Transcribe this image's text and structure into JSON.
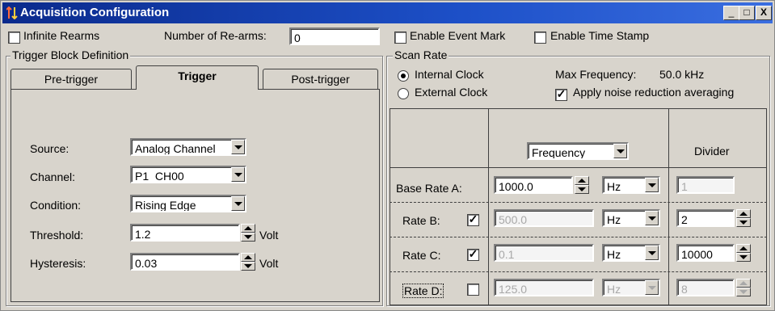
{
  "window": {
    "title": "Acquisition Configuration",
    "controls": [
      "_",
      "□",
      "X"
    ]
  },
  "top": {
    "infinite_rearms": {
      "label": "Infinite Rearms",
      "checked": false
    },
    "num_rearms": {
      "label": "Number of Re-arms:",
      "value": "0"
    },
    "enable_event_mark": {
      "label": "Enable Event Mark",
      "checked": false
    },
    "enable_time_stamp": {
      "label": "Enable Time Stamp",
      "checked": false
    }
  },
  "trigger_block": {
    "title": "Trigger Block Definition",
    "tabs": [
      {
        "label": "Pre-trigger",
        "active": false
      },
      {
        "label": "Trigger",
        "active": true
      },
      {
        "label": "Post-trigger",
        "active": false
      }
    ],
    "source": {
      "label": "Source:",
      "value": "Analog Channel"
    },
    "channel": {
      "label": "Channel:",
      "value": "P1_CH00"
    },
    "condition": {
      "label": "Condition:",
      "value": "Rising Edge"
    },
    "threshold": {
      "label": "Threshold:",
      "value": "1.2",
      "unit": "Volt"
    },
    "hysteresis": {
      "label": "Hysteresis:",
      "value": "0.03",
      "unit": "Volt"
    }
  },
  "scan_rate": {
    "title": "Scan Rate",
    "internal_clock": {
      "label": "Internal Clock",
      "selected": true
    },
    "external_clock": {
      "label": "External Clock",
      "selected": false
    },
    "max_frequency": {
      "label": "Max Frequency:",
      "value": "50.0 kHz"
    },
    "noise_reduction": {
      "label": "Apply noise reduction averaging",
      "checked": true
    },
    "table": {
      "mode_select": "Frequency",
      "divider_header": "Divider",
      "rows": [
        {
          "label": "Base Rate A:",
          "value": "1000.0",
          "unit": "Hz",
          "divider": "1",
          "has_check": false,
          "checked": false,
          "enabled": true
        },
        {
          "label": "Rate B:",
          "value": "500.0",
          "unit": "Hz",
          "divider": "2",
          "has_check": true,
          "checked": true,
          "enabled": true
        },
        {
          "label": "Rate C:",
          "value": "0.1",
          "unit": "Hz",
          "divider": "10000",
          "has_check": true,
          "checked": true,
          "enabled": true
        },
        {
          "label": "Rate D:",
          "value": "125.0",
          "unit": "Hz",
          "divider": "8",
          "has_check": true,
          "checked": false,
          "enabled": false
        }
      ]
    }
  }
}
